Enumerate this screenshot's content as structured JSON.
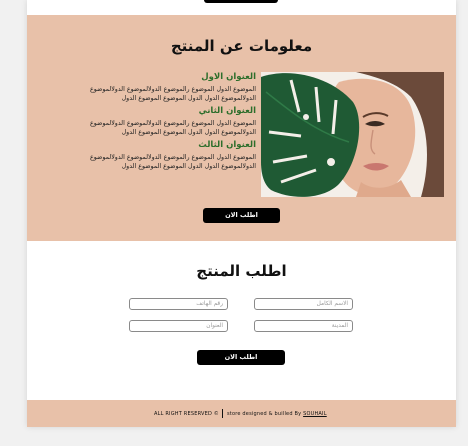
{
  "info": {
    "title": "معلومات عن المنتج",
    "sections": [
      {
        "heading": "العنوان الاول",
        "lines": [
          "الموضوع الدول الموضوع رالموضوع الدولالموضوع الدولالموضوع",
          "الدولالموضوع الدول الدول الموضوع الموضوع الدول"
        ]
      },
      {
        "heading": "العنوان الثاني",
        "lines": [
          "الموضوع الدول الموضوع رالموضوع الدولالموضوع الدولالموضوع",
          "الدولالموضوع الدول الدول الموضوع الموضوع الدول"
        ]
      },
      {
        "heading": "العنوان الثالث",
        "lines": [
          "الموضوع الدول الموضوع رالموضوع الدولالموضوع الدولالموضوع",
          "الدولالموضوع الدول الدول الموضوع الموضوع الدول"
        ]
      }
    ],
    "cta_label": "اطلب الان"
  },
  "order": {
    "title": "اطلب المنتج",
    "fields": {
      "full_name": "الاسم الكامل",
      "phone": "رقم الهاتف",
      "city": "المدينة",
      "address": "العنوان"
    },
    "submit_label": "اطلب الان"
  },
  "footer": {
    "rights": "ALL RIGHT RESERVED ©",
    "credit_prefix": "store designed & builled By",
    "credit_name": "SOUHAIL"
  },
  "colors": {
    "section_bg": "#e8c1a9",
    "heading_green": "#2d6e2b",
    "button": "#000000"
  }
}
